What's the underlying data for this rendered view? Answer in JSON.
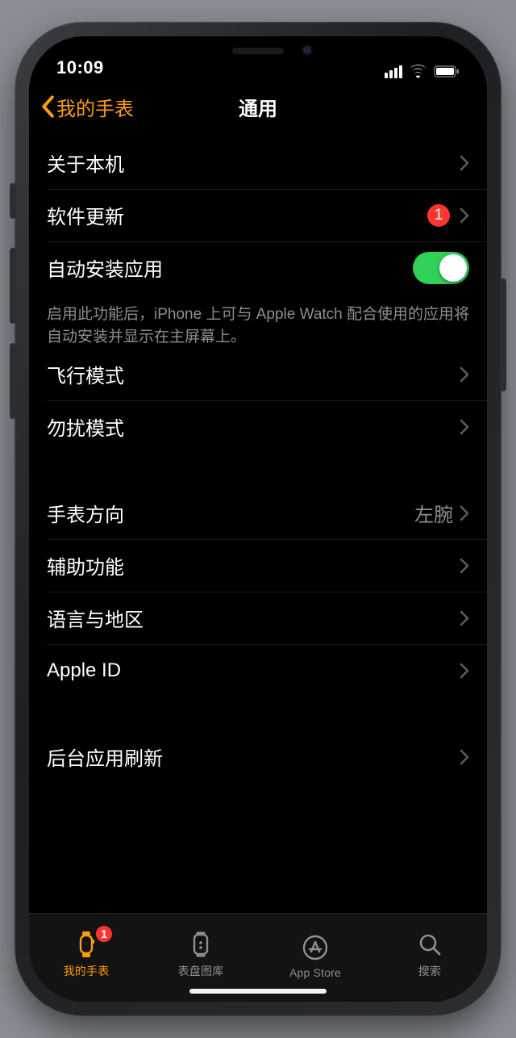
{
  "status": {
    "time": "10:09"
  },
  "nav": {
    "back": "我的手表",
    "title": "通用"
  },
  "groups": {
    "g1": {
      "about": "关于本机",
      "update": "软件更新",
      "updateBadge": "1",
      "autoInstall": "自动安装应用",
      "footer": "启用此功能后，iPhone 上可与 Apple Watch 配合使用的应用将自动安装并显示在主屏幕上。"
    },
    "g2": {
      "airplane": "飞行模式",
      "dnd": "勿扰模式"
    },
    "g3": {
      "orientation": "手表方向",
      "orientationValue": "左腕",
      "accessibility": "辅助功能",
      "language": "语言与地区",
      "appleId": "Apple ID"
    },
    "g4": {
      "backgroundRefresh": "后台应用刷新"
    }
  },
  "tabs": {
    "watch": {
      "label": "我的手表",
      "badge": "1"
    },
    "gallery": {
      "label": "表盘图库"
    },
    "store": {
      "label": "App Store"
    },
    "search": {
      "label": "搜索"
    }
  }
}
